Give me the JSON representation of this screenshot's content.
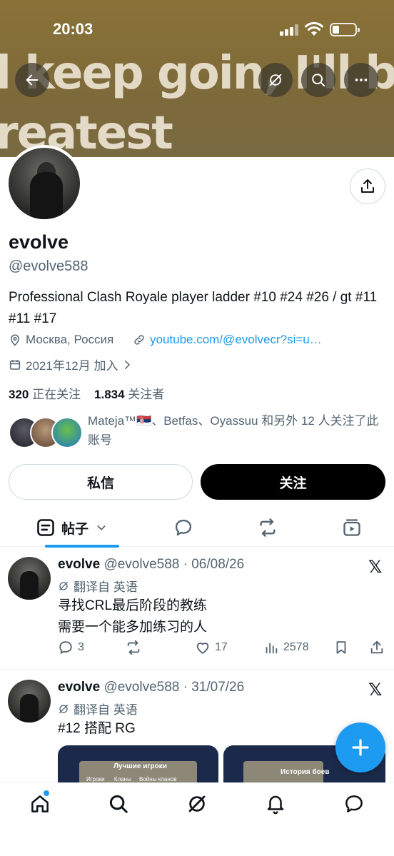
{
  "status_bar": {
    "time": "20:03",
    "battery_level": 0.3
  },
  "banner": {
    "line1": "l keep goin, I'll b",
    "line2": "reatest"
  },
  "header_icons": [
    "back-arrow-icon",
    "grok-icon",
    "search-icon",
    "more-icon"
  ],
  "profile": {
    "name": "evolve",
    "handle": "@evolve588",
    "bio": "Professional Clash Royale player ladder #10 #24 #26 / gt #11 #11 #17",
    "location": "Москва, Россия",
    "link": "youtube.com/@evolvecr?si=u…",
    "joined": "2021年12月 加入",
    "following_count": "320",
    "following_label": "正在关注",
    "followers_count": "1.834",
    "followers_label": "关注者",
    "followed_by": "Mateja™🇷🇸、Betfas、Oyassuu 和另外 12 人关注了此账号"
  },
  "buttons": {
    "dm": "私信",
    "follow": "关注"
  },
  "tabs": {
    "posts_label": "帖子"
  },
  "posts": [
    {
      "name": "evolve",
      "meta": "@evolve588 · 06/08/26",
      "translated": "翻译自 英语",
      "body": "寻找CRL最后阶段的教练\n需要一个能多加练习的人",
      "replies": "3",
      "reposts": "",
      "likes": "17",
      "views": "2578"
    },
    {
      "name": "evolve",
      "meta": "@evolve588 · 31/07/26",
      "translated": "翻译自 英语",
      "body": "#12 搭配 RG",
      "media1_title": "Лучшие игроки",
      "media1_tabs": [
        "Игроки",
        "Кланы",
        "Войны кланов"
      ],
      "media2_title": "История боев"
    }
  ],
  "colors": {
    "accent": "#1d9bf0",
    "text": "#0f1419",
    "muted": "#536471",
    "banner": "#8a7238"
  }
}
